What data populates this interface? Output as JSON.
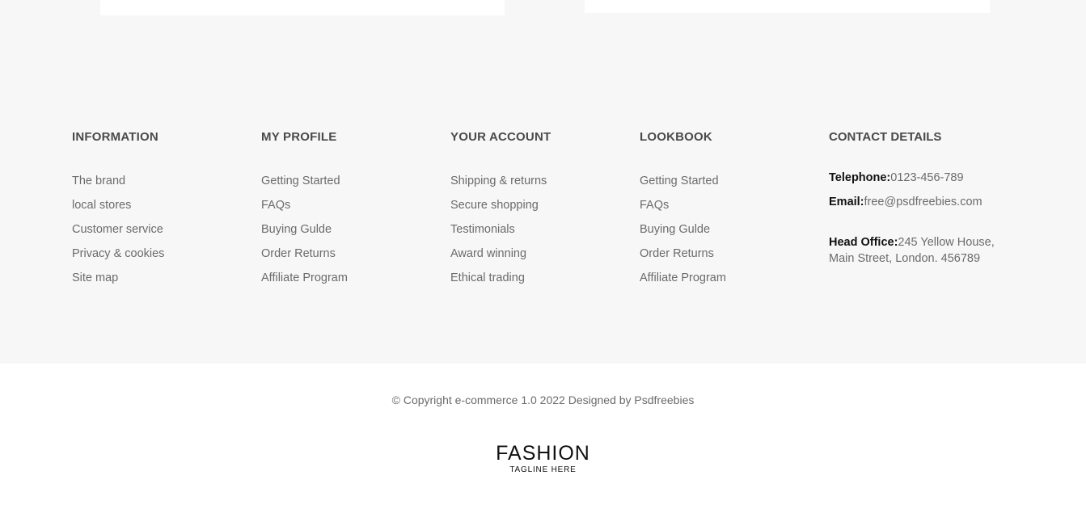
{
  "columns": [
    {
      "heading": "INFORMATION",
      "links": [
        "The brand",
        "local stores",
        "Customer service",
        "Privacy & cookies",
        "Site map"
      ]
    },
    {
      "heading": "MY PROFILE",
      "links": [
        "Getting Started",
        "FAQs",
        "Buying Gulde",
        "Order Returns",
        "Affiliate Program"
      ]
    },
    {
      "heading": "YOUR ACCOUNT",
      "links": [
        "Shipping & returns",
        "Secure shopping",
        "Testimonials",
        "Award winning",
        "Ethical trading"
      ]
    },
    {
      "heading": "LOOKBOOK",
      "links": [
        "Getting Started",
        "FAQs",
        "Buying Gulde",
        "Order Returns",
        "Affiliate Program"
      ]
    }
  ],
  "contact": {
    "heading": "CONTACT DETAILS",
    "telephone_label": "Telephone:",
    "telephone_value": "0123-456-789",
    "email_label": "Email:",
    "email_value": "free@psdfreebies.com",
    "office_label": "Head Office:",
    "office_line1": "245 Yellow House,",
    "office_line2": "Main Street, London. 456789"
  },
  "copyright": "© Copyright e-commerce 1.0 2022 Designed by Psdfreebies",
  "logo": {
    "name": "FASHION",
    "tagline": "TAGLINE HERE"
  },
  "colors": {
    "footer_bg": "#f7f7f7",
    "page_bg": "#ffffff",
    "heading": "#4a4a4a",
    "link": "#6b6b6b"
  }
}
